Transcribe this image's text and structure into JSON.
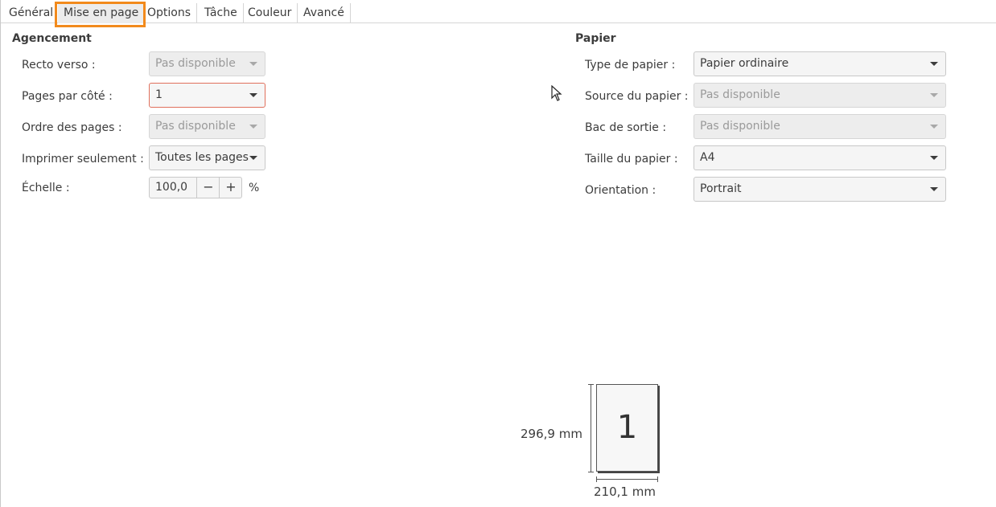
{
  "tabs": [
    {
      "label": "Général"
    },
    {
      "label": "Mise en page"
    },
    {
      "label": "Options"
    },
    {
      "label": "Tâche"
    },
    {
      "label": "Couleur"
    },
    {
      "label": "Avancé"
    }
  ],
  "layout": {
    "heading": "Agencement",
    "duplex": {
      "label": "Recto verso :",
      "value": "Pas disponible"
    },
    "pages_per_side": {
      "label": "Pages par côté :",
      "value": "1"
    },
    "page_order": {
      "label": "Ordre des pages :",
      "value": "Pas disponible"
    },
    "only_print": {
      "label": "Imprimer seulement :",
      "value": "Toutes les pages"
    },
    "scale": {
      "label": "Échelle :",
      "value": "100,0",
      "minus": "−",
      "plus": "+",
      "unit": "%"
    }
  },
  "paper": {
    "heading": "Papier",
    "type": {
      "label": "Type de papier :",
      "value": "Papier ordinaire"
    },
    "source": {
      "label": "Source du papier :",
      "value": "Pas disponible"
    },
    "output_tray": {
      "label": "Bac de sortie :",
      "value": "Pas disponible"
    },
    "size": {
      "label": "Taille du papier :",
      "value": "A4"
    },
    "orientation": {
      "label": "Orientation :",
      "value": "Portrait"
    }
  },
  "preview": {
    "page_number": "1",
    "height": "296,9 mm",
    "width": "210,1 mm"
  },
  "colors": {
    "highlight": "#f28a1c",
    "focus_border": "#e0705c"
  }
}
